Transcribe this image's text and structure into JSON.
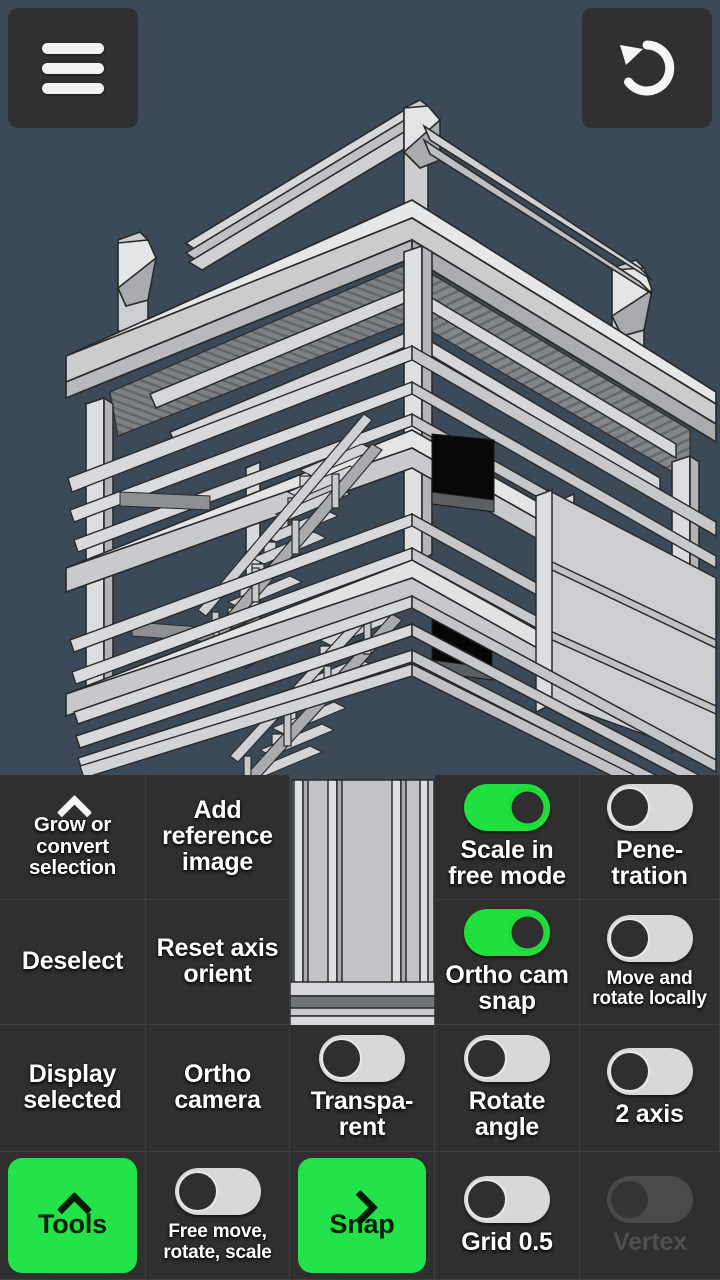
{
  "app": {
    "background_color": "#3c4a57",
    "panel_color": "#2f2f2f",
    "accent_color": "#22e34a"
  },
  "topbar": {
    "menu_button": {
      "name": "menu-button",
      "icon": "hamburger-menu-icon"
    },
    "undo_button": {
      "name": "undo-button",
      "icon": "undo-arrow-icon"
    }
  },
  "panel": {
    "cells": [
      {
        "id": "grow-or-convert-selection",
        "label": "Grow or convert selection",
        "type": "action",
        "icon": "chevron-up-icon",
        "size": "small"
      },
      {
        "id": "add-reference-image",
        "label": "Add reference image",
        "type": "action",
        "size": "normal"
      },
      {
        "id": "viewport-cutout-top",
        "label": "",
        "type": "transparent"
      },
      {
        "id": "scale-in-free-mode",
        "label": "Scale in free mode",
        "type": "toggle",
        "state": "on",
        "size": "normal"
      },
      {
        "id": "penetration",
        "label": "Pene- tration",
        "label_line1": "Pene-",
        "label_line2": "tration",
        "type": "toggle",
        "state": "off",
        "size": "normal"
      },
      {
        "id": "deselect",
        "label": "Deselect",
        "type": "action",
        "size": "normal"
      },
      {
        "id": "reset-axis-orient",
        "label": "Reset axis orient",
        "type": "action",
        "size": "normal"
      },
      {
        "id": "viewport-cutout-bottom",
        "label": "",
        "type": "transparent"
      },
      {
        "id": "ortho-cam-snap",
        "label": "Ortho cam snap",
        "type": "toggle",
        "state": "on",
        "size": "normal"
      },
      {
        "id": "move-and-rotate-locally",
        "label": "Move and rotate locally",
        "type": "toggle",
        "state": "off",
        "size": "tiny"
      },
      {
        "id": "display-selected",
        "label": "Display selected",
        "type": "action",
        "size": "normal"
      },
      {
        "id": "ortho-camera",
        "label": "Ortho camera",
        "type": "action",
        "size": "normal"
      },
      {
        "id": "transparent",
        "label": "Transpa- rent",
        "label_line1": "Transpa-",
        "label_line2": "rent",
        "type": "toggle",
        "state": "off",
        "size": "normal"
      },
      {
        "id": "rotate-angle",
        "label": "Rotate angle",
        "type": "toggle",
        "state": "off",
        "size": "normal"
      },
      {
        "id": "two-axis",
        "label": "2 axis",
        "type": "toggle",
        "state": "off",
        "size": "normal"
      },
      {
        "id": "tools",
        "label": "Tools",
        "type": "green-action",
        "icon": "chevron-up-icon"
      },
      {
        "id": "free-move-rotate-scale",
        "label": "Free move, rotate, scale",
        "type": "toggle",
        "state": "off",
        "size": "tiny"
      },
      {
        "id": "snap",
        "label": "Snap",
        "type": "green-action",
        "icon": "chevron-right-icon"
      },
      {
        "id": "grid",
        "label": "Grid 0.5",
        "type": "toggle",
        "state": "off",
        "size": "normal"
      },
      {
        "id": "vertex",
        "label": "Vertex",
        "type": "toggle",
        "state": "off",
        "size": "normal",
        "disabled": true
      }
    ]
  }
}
